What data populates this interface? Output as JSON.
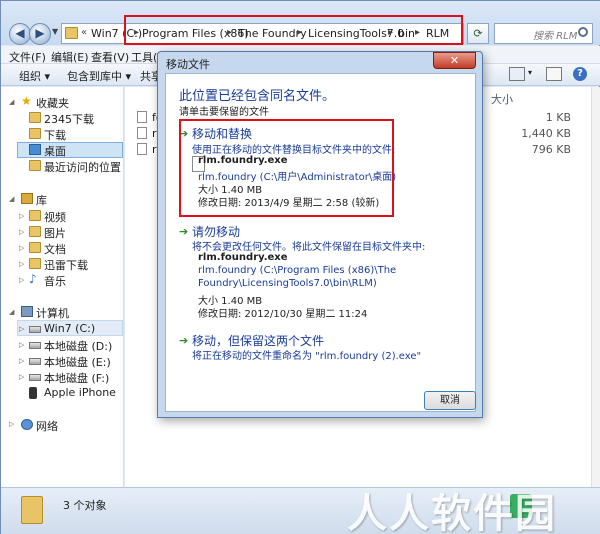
{
  "explorer": {
    "address": {
      "overflow": "«",
      "crumbs": [
        "Win7 (C:)",
        "Program Files (x86)",
        "The Foundry",
        "LicensingTools7.0",
        "bin",
        "RLM"
      ],
      "search_placeholder": "搜索 RLM"
    },
    "menu": [
      "文件(F)",
      "编辑(E)",
      "查看(V)",
      "工具(T)"
    ],
    "toolbar": {
      "organize": "组织 ▾",
      "include_in_library": "包含到库中 ▾",
      "share": "共享"
    },
    "nav": {
      "favorites": "收藏夹",
      "fav_items": [
        "2345下载",
        "下载",
        "桌面",
        "最近访问的位置"
      ],
      "libraries": "库",
      "lib_items": [
        "视频",
        "图片",
        "文档",
        "迅雷下载",
        "音乐"
      ],
      "computer": "计算机",
      "drives": [
        "Win7 (C:)",
        "本地磁盘 (D:)",
        "本地磁盘 (E:)",
        "本地磁盘 (F:)",
        "Apple iPhone"
      ],
      "network": "网络"
    },
    "content": {
      "size_header": "大小",
      "files": [
        {
          "name": "fo",
          "size": "1 KB"
        },
        {
          "name": "rl",
          "size": "1,440 KB"
        },
        {
          "name": "rl",
          "size": "796 KB"
        }
      ]
    },
    "status": {
      "count": "3 个对象"
    },
    "watermark": "人人软件园"
  },
  "dialog": {
    "title": "移动文件",
    "close": "✕",
    "heading": "此位置已经包含同名文件。",
    "subheading": "请单击要保留的文件",
    "replace": {
      "title": "移动和替换",
      "desc": "使用正在移动的文件替换目标文件夹中的文件:",
      "file": "rlm.foundry.exe",
      "location": "rlm.foundry (C:\\用户\\Administrator\\桌面)",
      "size": "大小 1.40 MB",
      "modified": "修改日期: 2013/4/9 星期二 2:58 (较新)"
    },
    "dont_move": {
      "title": "请勿移动",
      "desc": "将不会更改任何文件。将此文件保留在目标文件夹中:",
      "file": "rlm.foundry.exe",
      "location_line1": "rlm.foundry (C:\\Program Files (x86)\\The",
      "location_line2": "Foundry\\LicensingTools7.0\\bin\\RLM)",
      "size": "大小 1.40 MB",
      "modified": "修改日期: 2012/10/30 星期二 11:24"
    },
    "keep_both": {
      "title": "移动，但保留这两个文件",
      "desc": "将正在移动的文件重命名为 \"rlm.foundry (2).exe\""
    },
    "cancel": "取消"
  }
}
